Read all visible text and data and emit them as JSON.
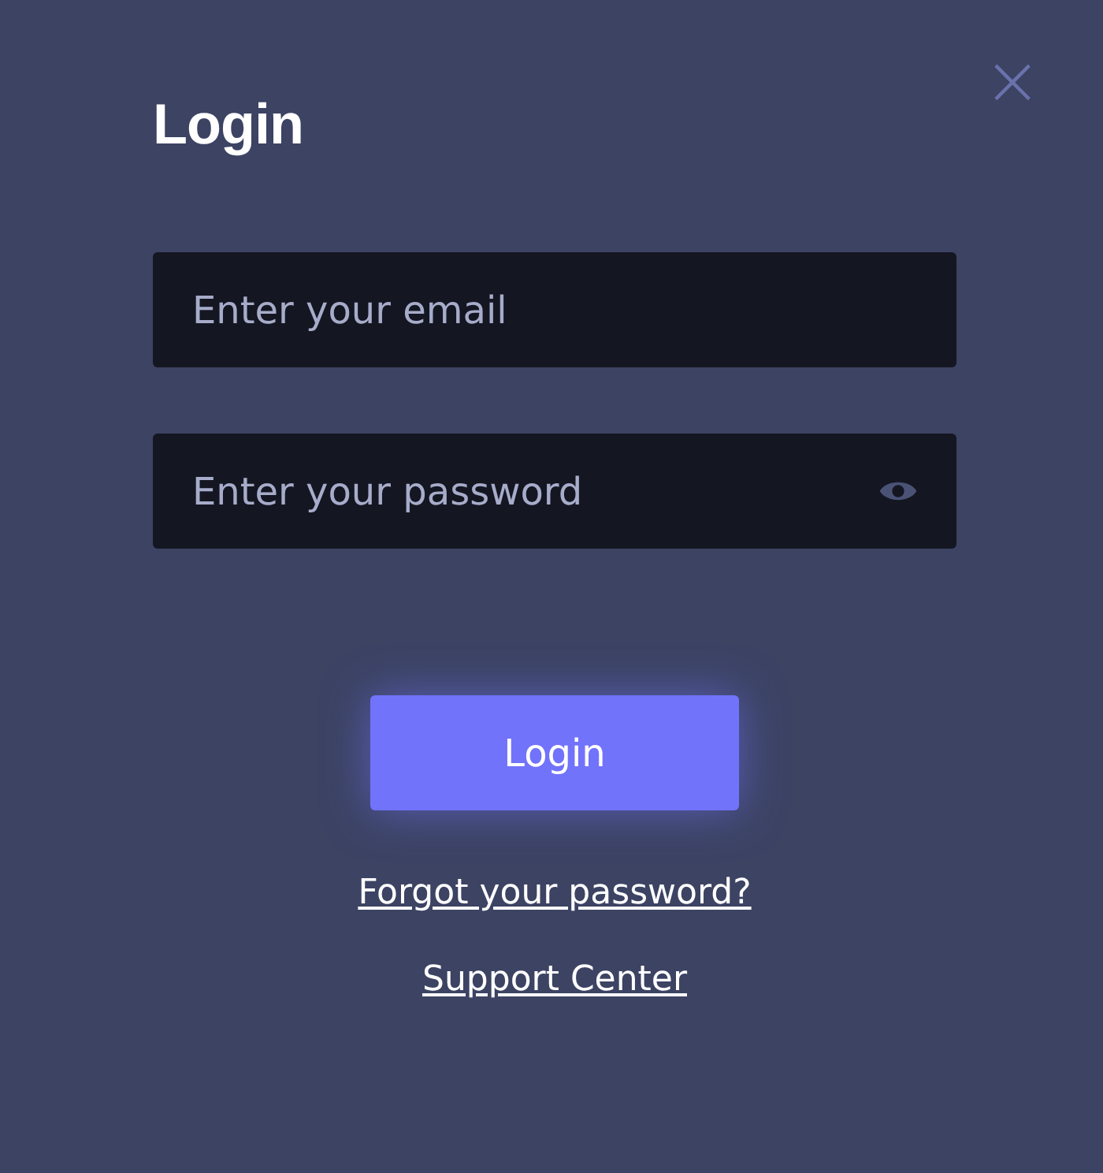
{
  "dialog": {
    "title": "Login",
    "close": "×"
  },
  "fields": [
    {
      "kind": "email",
      "placeholder": "Enter your email"
    },
    {
      "kind": "password",
      "placeholder": "Enter your password"
    }
  ],
  "button": "Login",
  "links": [
    "Forgot your password?",
    "Support Center"
  ]
}
